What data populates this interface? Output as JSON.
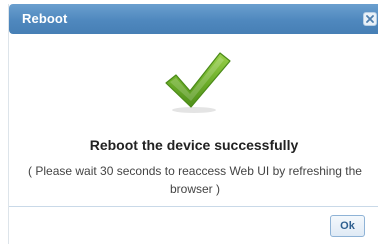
{
  "dialog": {
    "title": "Reboot",
    "close_icon": "close-icon",
    "status_icon": "checkmark-icon",
    "message": "Reboot the device successfully",
    "note": "( Please wait 30 seconds to reaccess Web UI by refreshing the browser )",
    "ok_label": "Ok"
  },
  "colors": {
    "titlebar": "#4f88be",
    "check_green": "#6fb02b",
    "ok_text": "#2e5f8f"
  }
}
